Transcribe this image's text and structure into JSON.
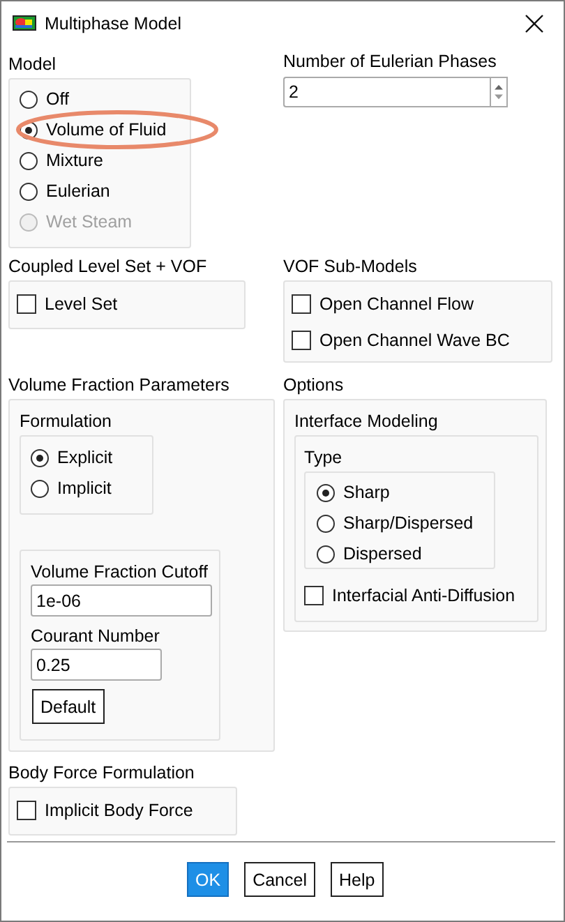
{
  "window": {
    "title": "Multiphase Model"
  },
  "model": {
    "label": "Model",
    "options": [
      {
        "label": "Off",
        "selected": false,
        "disabled": false,
        "highlighted": false
      },
      {
        "label": "Volume of Fluid",
        "selected": true,
        "disabled": false,
        "highlighted": true
      },
      {
        "label": "Mixture",
        "selected": false,
        "disabled": false,
        "highlighted": false
      },
      {
        "label": "Eulerian",
        "selected": false,
        "disabled": false,
        "highlighted": false
      },
      {
        "label": "Wet Steam",
        "selected": false,
        "disabled": true,
        "highlighted": false
      }
    ]
  },
  "eulerian_phases": {
    "label": "Number of Eulerian Phases",
    "value": "2"
  },
  "coupled_level_set": {
    "label": "Coupled Level Set + VOF",
    "options": [
      {
        "label": "Level Set",
        "checked": false
      }
    ]
  },
  "vof_sub_models": {
    "label": "VOF Sub-Models",
    "options": [
      {
        "label": "Open Channel Flow",
        "checked": false
      },
      {
        "label": "Open Channel Wave BC",
        "checked": false
      }
    ]
  },
  "volume_fraction_parameters": {
    "label": "Volume Fraction Parameters",
    "formulation": {
      "label": "Formulation",
      "options": [
        {
          "label": "Explicit",
          "selected": true
        },
        {
          "label": "Implicit",
          "selected": false
        }
      ]
    },
    "fields": [
      {
        "label": "Volume Fraction Cutoff",
        "value": "1e-06"
      },
      {
        "label": "Courant Number",
        "value": "0.25"
      }
    ],
    "default_button": "Default"
  },
  "options": {
    "label": "Options",
    "interface_modeling": {
      "label": "Interface Modeling",
      "type": {
        "label": "Type",
        "options": [
          {
            "label": "Sharp",
            "selected": true
          },
          {
            "label": "Sharp/Dispersed",
            "selected": false
          },
          {
            "label": "Dispersed",
            "selected": false
          }
        ]
      },
      "checks": [
        {
          "label": "Interfacial Anti-Diffusion",
          "checked": false
        }
      ]
    }
  },
  "body_force": {
    "label": "Body Force Formulation",
    "options": [
      {
        "label": "Implicit Body Force",
        "checked": false
      }
    ]
  },
  "buttons": [
    {
      "label": "OK",
      "default": true
    },
    {
      "label": "Cancel",
      "default": false
    },
    {
      "label": "Help",
      "default": false
    }
  ]
}
